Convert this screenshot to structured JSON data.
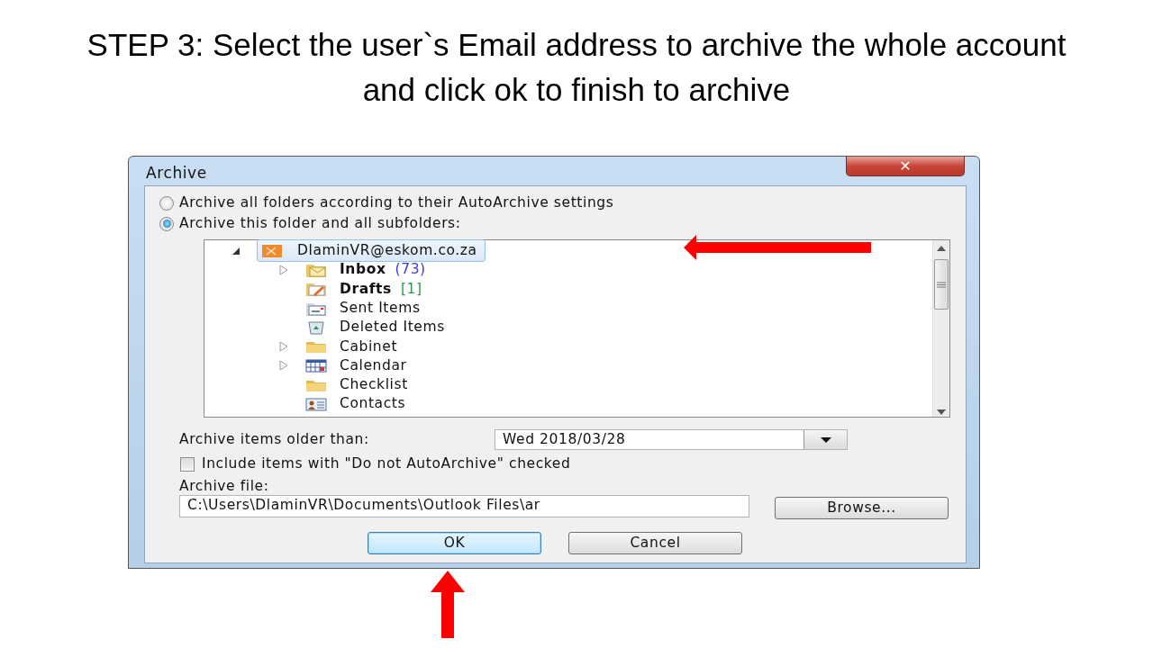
{
  "slide_title": "STEP 3: Select the user`s Email address to archive the whole account and click ok to finish to archive",
  "dialog": {
    "title": "Archive",
    "close": "✕",
    "options": [
      {
        "label": "Archive all folders according to their AutoArchive settings",
        "selected": false
      },
      {
        "label": "Archive this folder and all subfolders:",
        "selected": true
      }
    ],
    "tree": [
      {
        "label": "DlaminVR@eskom.co.za",
        "kind": "account",
        "selected": true,
        "expandable": true,
        "expanded": true,
        "unread": false,
        "children": [
          {
            "label": "Inbox",
            "count": "(73)",
            "color": "#3b3bdb",
            "kind": "inbox",
            "selected": false,
            "expandable": true,
            "unread": true
          },
          {
            "label": "Drafts",
            "count": "[1]",
            "color": "#2a9a4a",
            "kind": "drafts",
            "selected": false,
            "expandable": false,
            "unread": true
          },
          {
            "label": "Sent Items",
            "kind": "sent",
            "selected": false,
            "expandable": false,
            "unread": false
          },
          {
            "label": "Deleted Items",
            "kind": "deleted",
            "selected": false,
            "expandable": false,
            "unread": false
          },
          {
            "label": "Cabinet",
            "kind": "folder",
            "selected": false,
            "expandable": true,
            "unread": false
          },
          {
            "label": "Calendar",
            "kind": "calendar",
            "selected": false,
            "expandable": true,
            "unread": false
          },
          {
            "label": "Checklist",
            "kind": "folder",
            "selected": false,
            "expandable": false,
            "unread": false
          },
          {
            "label": "Contacts",
            "kind": "contacts",
            "selected": false,
            "expandable": false,
            "unread": false
          }
        ]
      }
    ],
    "older_than": {
      "label": "Archive items older than:",
      "value": "Wed 2018/03/28"
    },
    "include": {
      "label": "Include items with \"Do not AutoArchive\" checked",
      "checked": false
    },
    "archive_file": {
      "label": "Archive file:",
      "value": "C:\\Users\\DlaminVR\\Documents\\Outlook Files\\ar"
    },
    "browse": "Browse...",
    "buttons": [
      {
        "label": "OK",
        "default": true
      },
      {
        "label": "Cancel",
        "default": false
      }
    ]
  }
}
